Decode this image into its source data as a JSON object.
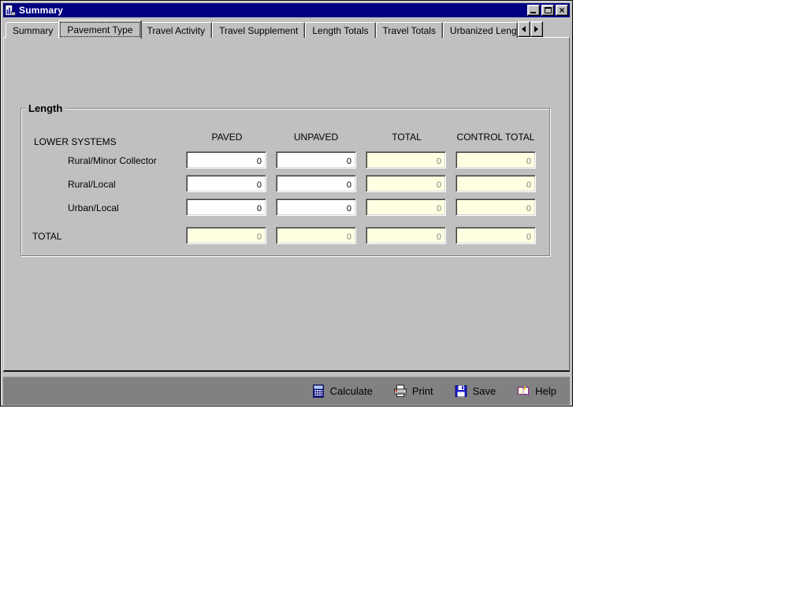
{
  "window": {
    "title": "Summary"
  },
  "tab_bar": {
    "active_tab": "Pavement Type",
    "tabs": [
      {
        "label": "Summary"
      },
      {
        "label": "Pavement Type"
      },
      {
        "label": "Travel Activity"
      },
      {
        "label": "Travel Supplement"
      },
      {
        "label": "Length Totals"
      },
      {
        "label": "Travel Totals"
      },
      {
        "label": "Urbanized Leng"
      }
    ]
  },
  "form": {
    "group_title": "Length",
    "row_group_header": "LOWER SYSTEMS",
    "columns": [
      "PAVED",
      "UNPAVED",
      "TOTAL",
      "CONTROL TOTAL"
    ],
    "rows": [
      {
        "label": "Rural/Minor Collector",
        "paved": "0",
        "unpaved": "0",
        "total": "0",
        "control_total": "0"
      },
      {
        "label": "Rural/Local",
        "paved": "0",
        "unpaved": "0",
        "total": "0",
        "control_total": "0"
      },
      {
        "label": "Urban/Local",
        "paved": "0",
        "unpaved": "0",
        "total": "0",
        "control_total": "0"
      },
      {
        "label": "TOTAL",
        "paved": "0",
        "unpaved": "0",
        "total": "0",
        "control_total": "0"
      }
    ]
  },
  "toolbar": {
    "buttons": [
      {
        "label": "Calculate",
        "icon": "calculator-icon"
      },
      {
        "label": "Print",
        "icon": "printer-icon"
      },
      {
        "label": "Save",
        "icon": "floppy-disk-icon"
      },
      {
        "label": "Help",
        "icon": "help-book-icon"
      }
    ]
  },
  "colors": {
    "titlebar": "#000080",
    "chrome": "#c0c0c0",
    "toolbar_bg": "#818181",
    "editable_field_bg": "#ffffff",
    "readonly_field_bg": "#ffffe1",
    "disabled_text": "#808080"
  }
}
